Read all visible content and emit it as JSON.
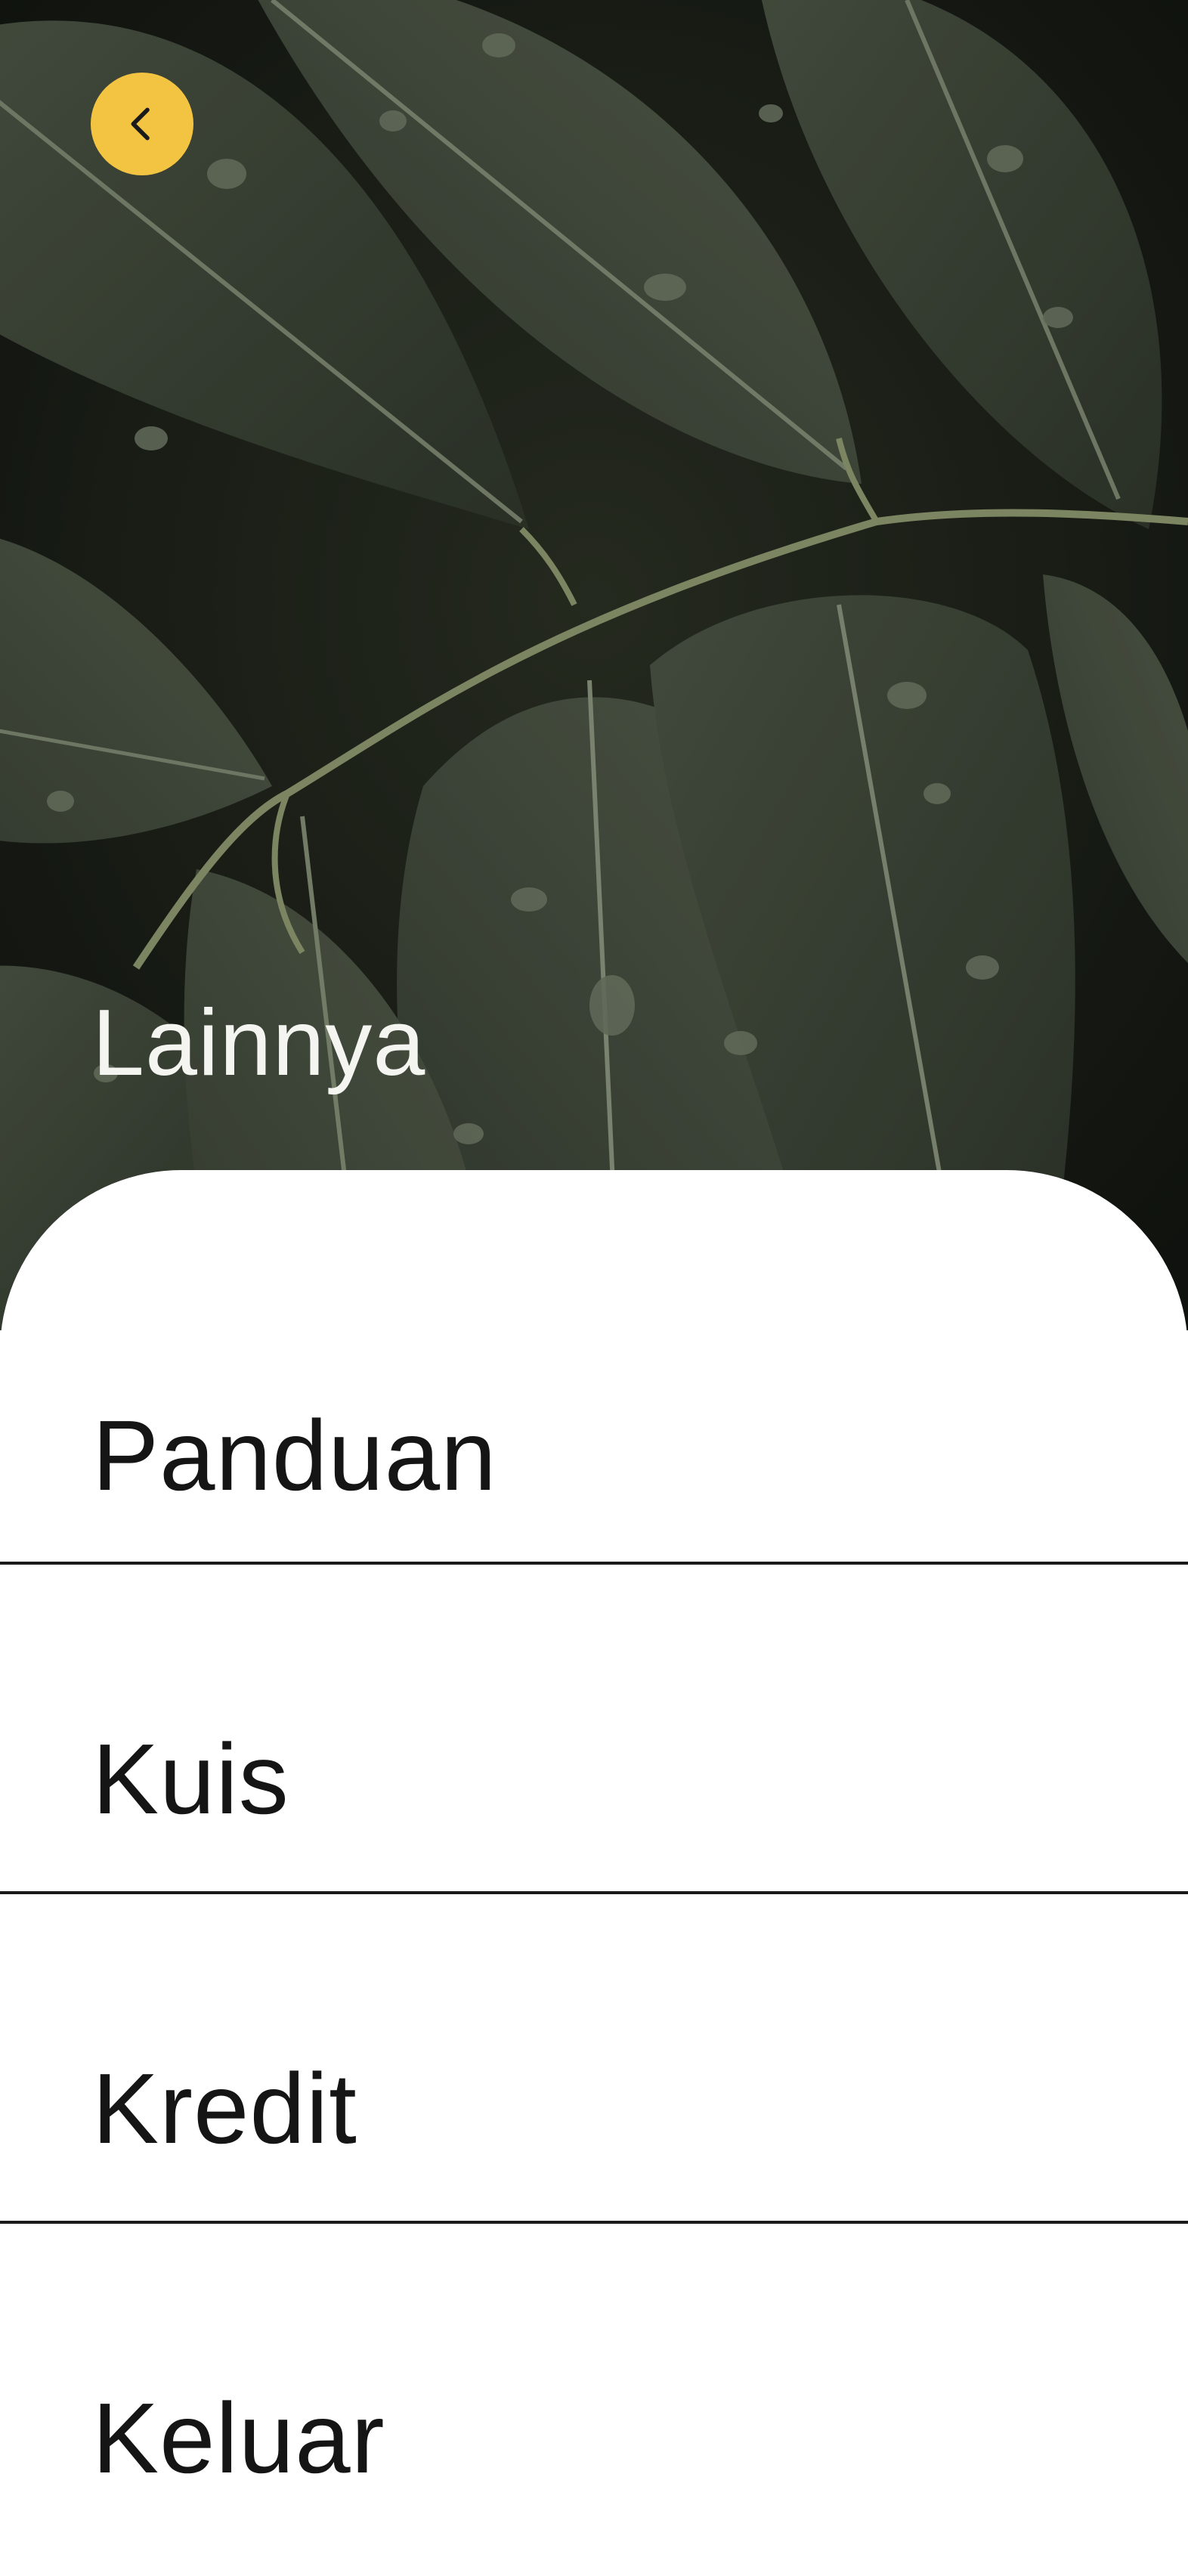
{
  "header": {
    "title": "Lainnya",
    "back_icon": "chevron-left-icon",
    "accent_color": "#f2c441"
  },
  "menu": {
    "items": [
      {
        "label": "Panduan"
      },
      {
        "label": "Kuis"
      },
      {
        "label": "Kredit"
      },
      {
        "label": "Keluar"
      }
    ]
  }
}
